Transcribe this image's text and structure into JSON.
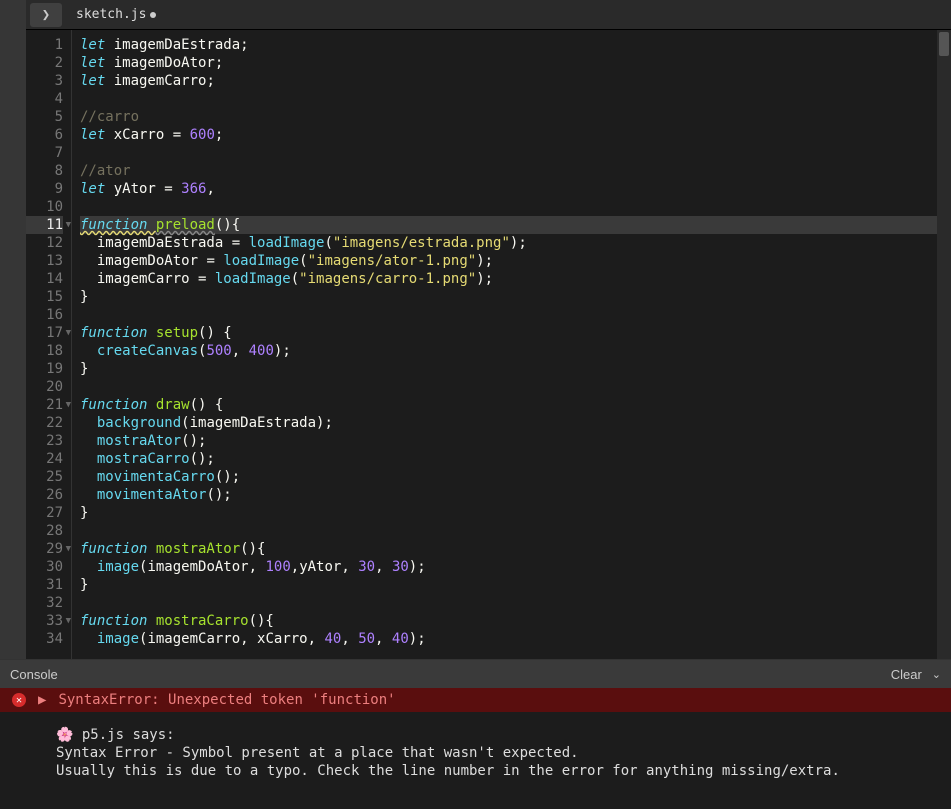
{
  "tab": {
    "filename": "sketch.js",
    "dirty": true
  },
  "console_header": {
    "title": "Console",
    "clear_label": "Clear"
  },
  "error_banner": "SyntaxError: Unexpected token 'function'",
  "p5_message": {
    "prefix_icon": "🌸",
    "says": " p5.js says:",
    "line1": "Syntax Error - Symbol present at a place that wasn't expected.",
    "line2": "Usually this is due to a typo. Check the line number in the error for anything missing/extra."
  },
  "code": {
    "lines": [
      {
        "n": 1,
        "tokens": [
          {
            "t": "let ",
            "c": "kw"
          },
          {
            "t": "imagemDaEstrada",
            "c": "dv"
          },
          {
            "t": ";",
            "c": "pn"
          }
        ]
      },
      {
        "n": 2,
        "tokens": [
          {
            "t": "let ",
            "c": "kw"
          },
          {
            "t": "imagemDoAtor",
            "c": "dv"
          },
          {
            "t": ";",
            "c": "pn"
          }
        ]
      },
      {
        "n": 3,
        "tokens": [
          {
            "t": "let ",
            "c": "kw"
          },
          {
            "t": "imagemCarro",
            "c": "dv"
          },
          {
            "t": ";",
            "c": "pn"
          }
        ]
      },
      {
        "n": 4,
        "tokens": []
      },
      {
        "n": 5,
        "tokens": [
          {
            "t": "//carro",
            "c": "cm"
          }
        ]
      },
      {
        "n": 6,
        "tokens": [
          {
            "t": "let ",
            "c": "kw"
          },
          {
            "t": "xCarro",
            "c": "dv"
          },
          {
            "t": " = ",
            "c": "pn"
          },
          {
            "t": "600",
            "c": "nm"
          },
          {
            "t": ";",
            "c": "pn"
          }
        ]
      },
      {
        "n": 7,
        "tokens": []
      },
      {
        "n": 8,
        "tokens": [
          {
            "t": "//ator",
            "c": "cm"
          }
        ]
      },
      {
        "n": 9,
        "tokens": [
          {
            "t": "let ",
            "c": "kw"
          },
          {
            "t": "yAtor",
            "c": "dv"
          },
          {
            "t": " = ",
            "c": "pn"
          },
          {
            "t": "366",
            "c": "nm"
          },
          {
            "t": ",",
            "c": "pn"
          }
        ]
      },
      {
        "n": 10,
        "tokens": []
      },
      {
        "n": 11,
        "hi": true,
        "fold": true,
        "tokens": [
          {
            "t": "function ",
            "c": "kw err-underline"
          },
          {
            "t": "preload",
            "c": "fn err-underline2"
          },
          {
            "t": "(){",
            "c": "pn"
          }
        ]
      },
      {
        "n": 12,
        "tokens": [
          {
            "t": "  imagemDaEstrada",
            "c": "dv"
          },
          {
            "t": " = ",
            "c": "pn"
          },
          {
            "t": "loadImage",
            "c": "bl"
          },
          {
            "t": "(",
            "c": "pn"
          },
          {
            "t": "\"imagens/estrada.png\"",
            "c": "st"
          },
          {
            "t": ");",
            "c": "pn"
          }
        ]
      },
      {
        "n": 13,
        "tokens": [
          {
            "t": "  imagemDoAtor",
            "c": "dv"
          },
          {
            "t": " = ",
            "c": "pn"
          },
          {
            "t": "loadImage",
            "c": "bl"
          },
          {
            "t": "(",
            "c": "pn"
          },
          {
            "t": "\"imagens/ator-1.png\"",
            "c": "st"
          },
          {
            "t": ");",
            "c": "pn"
          }
        ]
      },
      {
        "n": 14,
        "tokens": [
          {
            "t": "  imagemCarro",
            "c": "dv"
          },
          {
            "t": " = ",
            "c": "pn"
          },
          {
            "t": "loadImage",
            "c": "bl"
          },
          {
            "t": "(",
            "c": "pn"
          },
          {
            "t": "\"imagens/carro-1.png\"",
            "c": "st"
          },
          {
            "t": ");",
            "c": "pn"
          }
        ]
      },
      {
        "n": 15,
        "tokens": [
          {
            "t": "}",
            "c": "pn"
          }
        ]
      },
      {
        "n": 16,
        "tokens": []
      },
      {
        "n": 17,
        "fold": true,
        "tokens": [
          {
            "t": "function ",
            "c": "kw"
          },
          {
            "t": "setup",
            "c": "fn"
          },
          {
            "t": "() {",
            "c": "pn"
          }
        ]
      },
      {
        "n": 18,
        "tokens": [
          {
            "t": "  ",
            "c": "pn"
          },
          {
            "t": "createCanvas",
            "c": "bl"
          },
          {
            "t": "(",
            "c": "pn"
          },
          {
            "t": "500",
            "c": "nm"
          },
          {
            "t": ", ",
            "c": "pn"
          },
          {
            "t": "400",
            "c": "nm"
          },
          {
            "t": ");",
            "c": "pn"
          }
        ]
      },
      {
        "n": 19,
        "tokens": [
          {
            "t": "}",
            "c": "pn"
          }
        ]
      },
      {
        "n": 20,
        "tokens": []
      },
      {
        "n": 21,
        "fold": true,
        "tokens": [
          {
            "t": "function ",
            "c": "kw"
          },
          {
            "t": "draw",
            "c": "fn"
          },
          {
            "t": "() {",
            "c": "pn"
          }
        ]
      },
      {
        "n": 22,
        "tokens": [
          {
            "t": "  ",
            "c": "pn"
          },
          {
            "t": "background",
            "c": "bl"
          },
          {
            "t": "(",
            "c": "pn"
          },
          {
            "t": "imagemDaEstrada",
            "c": "dv"
          },
          {
            "t": ");",
            "c": "pn"
          }
        ]
      },
      {
        "n": 23,
        "tokens": [
          {
            "t": "  ",
            "c": "pn"
          },
          {
            "t": "mostraAtor",
            "c": "bl"
          },
          {
            "t": "();",
            "c": "pn"
          }
        ]
      },
      {
        "n": 24,
        "tokens": [
          {
            "t": "  ",
            "c": "pn"
          },
          {
            "t": "mostraCarro",
            "c": "bl"
          },
          {
            "t": "();",
            "c": "pn"
          }
        ]
      },
      {
        "n": 25,
        "tokens": [
          {
            "t": "  ",
            "c": "pn"
          },
          {
            "t": "movimentaCarro",
            "c": "bl"
          },
          {
            "t": "();",
            "c": "pn"
          }
        ]
      },
      {
        "n": 26,
        "tokens": [
          {
            "t": "  ",
            "c": "pn"
          },
          {
            "t": "movimentaAtor",
            "c": "bl"
          },
          {
            "t": "();",
            "c": "pn"
          }
        ]
      },
      {
        "n": 27,
        "tokens": [
          {
            "t": "}",
            "c": "pn"
          }
        ]
      },
      {
        "n": 28,
        "tokens": []
      },
      {
        "n": 29,
        "fold": true,
        "tokens": [
          {
            "t": "function ",
            "c": "kw"
          },
          {
            "t": "mostraAtor",
            "c": "fn"
          },
          {
            "t": "(){",
            "c": "pn"
          }
        ]
      },
      {
        "n": 30,
        "tokens": [
          {
            "t": "  ",
            "c": "pn"
          },
          {
            "t": "image",
            "c": "bl"
          },
          {
            "t": "(",
            "c": "pn"
          },
          {
            "t": "imagemDoAtor",
            "c": "dv"
          },
          {
            "t": ", ",
            "c": "pn"
          },
          {
            "t": "100",
            "c": "nm"
          },
          {
            "t": ",",
            "c": "pn"
          },
          {
            "t": "yAtor",
            "c": "dv"
          },
          {
            "t": ", ",
            "c": "pn"
          },
          {
            "t": "30",
            "c": "nm"
          },
          {
            "t": ", ",
            "c": "pn"
          },
          {
            "t": "30",
            "c": "nm"
          },
          {
            "t": ");",
            "c": "pn"
          }
        ]
      },
      {
        "n": 31,
        "tokens": [
          {
            "t": "}",
            "c": "pn"
          }
        ]
      },
      {
        "n": 32,
        "tokens": []
      },
      {
        "n": 33,
        "fold": true,
        "tokens": [
          {
            "t": "function ",
            "c": "kw"
          },
          {
            "t": "mostraCarro",
            "c": "fn"
          },
          {
            "t": "(){",
            "c": "pn"
          }
        ]
      },
      {
        "n": 34,
        "tokens": [
          {
            "t": "  ",
            "c": "pn"
          },
          {
            "t": "image",
            "c": "bl"
          },
          {
            "t": "(",
            "c": "pn"
          },
          {
            "t": "imagemCarro",
            "c": "dv"
          },
          {
            "t": ", ",
            "c": "pn"
          },
          {
            "t": "xCarro",
            "c": "dv"
          },
          {
            "t": ", ",
            "c": "pn"
          },
          {
            "t": "40",
            "c": "nm"
          },
          {
            "t": ", ",
            "c": "pn"
          },
          {
            "t": "50",
            "c": "nm"
          },
          {
            "t": ", ",
            "c": "pn"
          },
          {
            "t": "40",
            "c": "nm"
          },
          {
            "t": ");",
            "c": "pn"
          }
        ]
      }
    ]
  }
}
